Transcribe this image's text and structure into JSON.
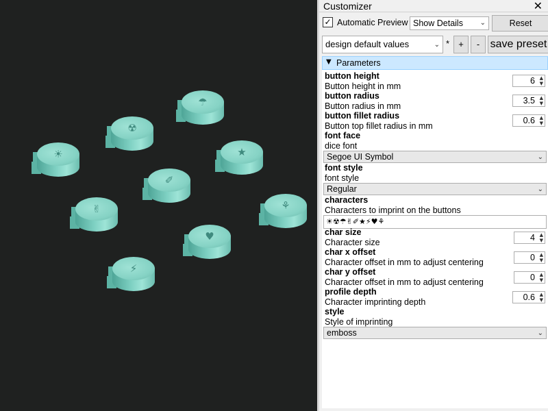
{
  "viewport": {
    "buttons": [
      {
        "glyph": "☀"
      },
      {
        "glyph": "☢"
      },
      {
        "glyph": "☂"
      },
      {
        "glyph": "✌"
      },
      {
        "glyph": "✐"
      },
      {
        "glyph": "★"
      },
      {
        "glyph": "⚡"
      },
      {
        "glyph": "♥"
      },
      {
        "glyph": "⚘"
      }
    ]
  },
  "panel": {
    "title": "Customizer",
    "close_glyph": "✕",
    "auto_preview_checked": "✓",
    "auto_preview_label": "Automatic Preview",
    "details_select": "Show Details",
    "reset_label": "Reset",
    "preset_select": "design default values",
    "asterisk": "*",
    "plus_label": "+",
    "minus_label": "-",
    "save_preset_label": "save preset",
    "section_label": "Parameters",
    "params": {
      "button_height": {
        "name": "button height",
        "desc": "Button height in mm",
        "value": "6"
      },
      "button_radius": {
        "name": "button radius",
        "desc": "Button radius in mm",
        "value": "3.5"
      },
      "button_fillet_radius": {
        "name": "button fillet radius",
        "desc": "Button top fillet radius in mm",
        "value": "0.6"
      },
      "font_face": {
        "name": "font face",
        "desc": "dice font",
        "value": "Segoe UI Symbol"
      },
      "font_style": {
        "name": "font style",
        "desc": "font style",
        "value": "Regular"
      },
      "characters": {
        "name": "characters",
        "desc": "Characters to imprint on the buttons",
        "value": "☀☢☂✌✐★⚡♥⚘"
      },
      "char_size": {
        "name": "char size",
        "desc": "Character size",
        "value": "4"
      },
      "char_x_offset": {
        "name": "char x offset",
        "desc": "Character offset in mm to adjust centering",
        "value": "0"
      },
      "char_y_offset": {
        "name": "char y offset",
        "desc": "Character offset in mm to adjust centering",
        "value": "0"
      },
      "profile_depth": {
        "name": "profile depth",
        "desc": "Character imprinting depth",
        "value": "0.6"
      },
      "style": {
        "name": "style",
        "desc": "Style of imprinting",
        "value": "emboss"
      }
    }
  }
}
